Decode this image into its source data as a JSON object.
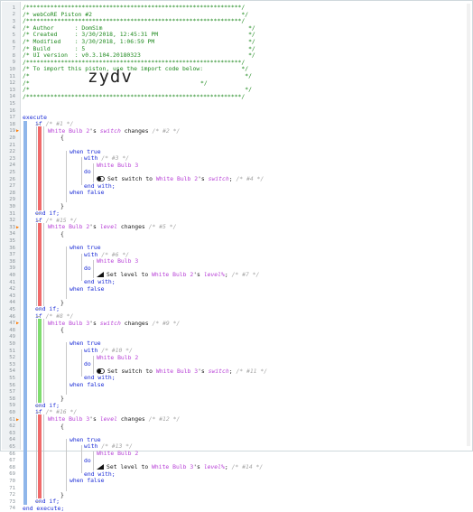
{
  "header": {
    "border_top": "/**************************************************************/",
    "title": "/* webCoRE Piston #2                                           */",
    "border_mid": "/**************************************************************/",
    "author": "/* Author      : DomSim                                          */",
    "created": "/* Created     : 3/30/2018, 12:45:31 PM                          */",
    "modified": "/* Modified    : 3/30/2018, 1:06:59 PM                           */",
    "build": "/* Build       : 5                                               */",
    "ui": "/* UI version  : v0.3.104.20180323                               */",
    "border_2": "/**************************************************************/",
    "import_note": "/* To import this piston, use the import code below:           */",
    "blank1": "/*                                                              */",
    "code_prefix": "/*",
    "import_code": "zydv",
    "code_suffix": "*/",
    "blank2": "/*                                                              */",
    "border_bottom": "/**************************************************************/"
  },
  "keywords": {
    "execute": "execute",
    "end_execute": "end execute;",
    "if": "if",
    "end_if": "end if;",
    "open_brace": "{",
    "close_brace": "}",
    "when_true": "when true",
    "when_false": "when false",
    "with": "with",
    "do": "do",
    "end_with": "end with;",
    "possessive": "'s",
    "changes": "changes",
    "set_switch": "Set switch to",
    "set_level": "Set level to"
  },
  "blocks": [
    {
      "if_comment": "/* #1 */",
      "device": "White Bulb 2",
      "attribute": "switch",
      "cond_comment": "/* #2 */",
      "with_comment": "/* #3 */",
      "target": "White Bulb 3",
      "action": "set_switch",
      "source_device": "White Bulb 2",
      "source_attr": "switch",
      "task_comment": "/* #4 */",
      "task_icon": "toggle-icon"
    },
    {
      "if_comment": "/* #15 */",
      "device": "White Bulb 2",
      "attribute": "level",
      "cond_comment": "/* #5 */",
      "with_comment": "/* #6 */",
      "target": "White Bulb 3",
      "action": "set_level",
      "source_device": "White Bulb 2",
      "source_attr": "level%",
      "task_comment": "/* #7 */",
      "task_icon": "level-icon"
    },
    {
      "if_comment": "/* #8 */",
      "device": "White Bulb 3",
      "attribute": "switch",
      "cond_comment": "/* #9 */",
      "with_comment": "/* #10 */",
      "target": "White Bulb 2",
      "action": "set_switch",
      "source_device": "White Bulb 3",
      "source_attr": "switch",
      "task_comment": "/* #11 */",
      "task_icon": "toggle-icon"
    },
    {
      "if_comment": "/* #16 */",
      "device": "White Bulb 3",
      "attribute": "level",
      "cond_comment": "/* #12 */",
      "with_comment": "/* #13 */",
      "target": "White Bulb 2",
      "action": "set_level",
      "source_device": "White Bulb 3",
      "source_attr": "level%",
      "task_comment": "/* #14 */",
      "task_icon": "level-icon"
    }
  ],
  "toggle_marker": "▶",
  "block_status": [
    "red",
    "red",
    "green",
    "red"
  ],
  "colors": {
    "comment": "#1f8a1f",
    "keyword": "#1a2bd6",
    "device": "#b73fd6",
    "annotation": "#a4a4a4",
    "execute_bar": "#8fb6ea",
    "status_red": "#f06a6a",
    "status_green": "#7fdc6f",
    "marker": "#ff7a00"
  }
}
